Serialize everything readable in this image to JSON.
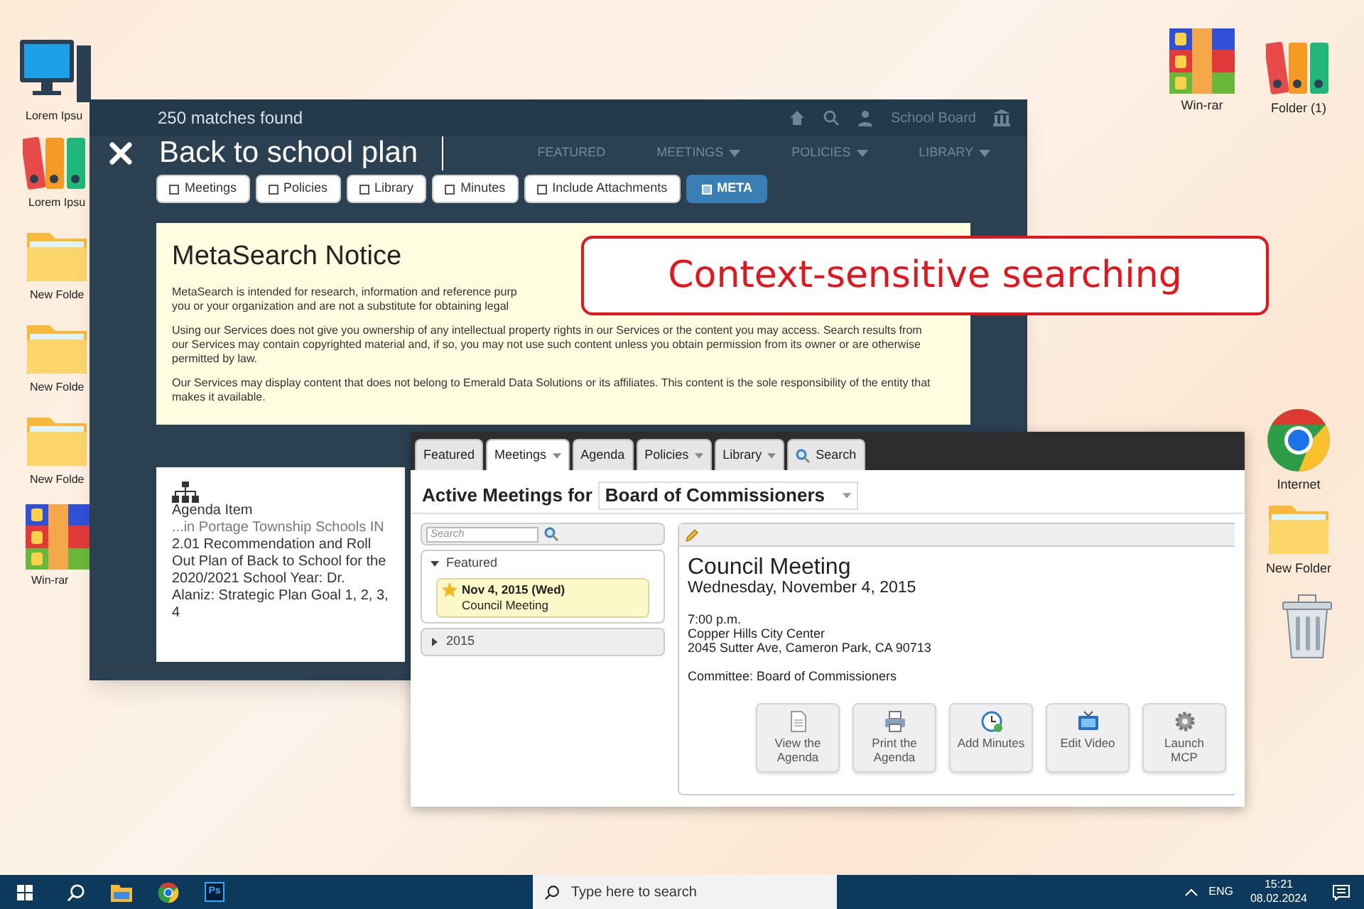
{
  "desktop_icons_left": [
    {
      "kind": "computer",
      "label": "Lorem Ipsu"
    },
    {
      "kind": "binders",
      "label": "Lorem Ipsu"
    },
    {
      "kind": "folder",
      "label": "New Folde"
    },
    {
      "kind": "folder",
      "label": "New Folde"
    },
    {
      "kind": "folder",
      "label": "New Folde"
    },
    {
      "kind": "winrar",
      "label": "Win-rar"
    }
  ],
  "desktop_icons_right": [
    {
      "kind": "winrar",
      "label": "Win-rar"
    },
    {
      "kind": "binders",
      "label": "Folder (1)"
    },
    {
      "kind": "chrome",
      "label": "Internet"
    },
    {
      "kind": "folder",
      "label": "New Folder"
    },
    {
      "kind": "trash"
    }
  ],
  "site_header": {
    "account": "School Board",
    "nav": [
      {
        "label": "FEATURED",
        "dropdown": false
      },
      {
        "label": "MEETINGS",
        "dropdown": true
      },
      {
        "label": "POLICIES",
        "dropdown": true
      },
      {
        "label": "LIBRARY",
        "dropdown": true
      }
    ]
  },
  "metasearch": {
    "match_count": "250 matches found",
    "query": "Back to school plan",
    "filters": [
      {
        "label": "Meetings",
        "checked": false
      },
      {
        "label": "Policies",
        "checked": false
      },
      {
        "label": "Library",
        "checked": false
      },
      {
        "label": "Minutes",
        "checked": false
      },
      {
        "label": "Include Attachments",
        "checked": false
      },
      {
        "label": "META",
        "checked": true
      }
    ],
    "notice": {
      "title": "MetaSearch Notice",
      "cut_lines": [
        "MetaSearch is intended for research, information and reference purp",
        "you or your organization and are not a substitute for obtaining legal"
      ],
      "paragraphs": [
        "Using our Services does not give you ownership of any intellectual property rights in our Services or the content you may access. Search results from our Services may contain copyrighted material and, if so, you may not use such content unless you obtain permission from its owner or are otherwise permitted by law.",
        "Our Services may display content that does not belong to Emerald Data Solutions or its affiliates. This content is the sole responsibility of the entity that makes it available."
      ]
    },
    "results": [
      {
        "type": "Agenda Item",
        "source": "...in Portage Township Schools IN",
        "text": "2.01 Recommendation and Roll Out Plan of Back to School for the 2020/2021 School Year: Dr. Alaniz: Strategic Plan Goal 1, 2, 3, 4"
      }
    ]
  },
  "callout": "Context-sensitive searching",
  "meetings_window": {
    "tabs": [
      {
        "label": "Featured",
        "kind": "plain",
        "selected": false
      },
      {
        "label": "Meetings",
        "kind": "menu",
        "selected": true
      },
      {
        "label": "Agenda",
        "kind": "plain",
        "selected": false
      },
      {
        "label": "Policies",
        "kind": "menu",
        "selected": false
      },
      {
        "label": "Library",
        "kind": "menu",
        "selected": false
      },
      {
        "label": "Search",
        "kind": "search",
        "selected": false
      }
    ],
    "heading": "Active Meetings for",
    "body_select": "Board of Commissioners",
    "search": {
      "placeholder": "Search"
    },
    "tree": [
      {
        "label": "Featured",
        "expanded": true,
        "children": [
          {
            "date": "Nov 4, 2015 (Wed)",
            "title": "Council Meeting",
            "starred": true
          }
        ]
      },
      {
        "label": "2015",
        "expanded": false
      }
    ],
    "detail": {
      "title": "Council Meeting",
      "date": "Wednesday, November 4, 2015",
      "time": "7:00 p.m.",
      "location": [
        "Copper Hills City Center",
        "2045 Sutter Ave, Cameron Park, CA 90713"
      ],
      "committee": "Committee: Board of Commissioners",
      "actions": [
        {
          "kind": "document",
          "label": "View the Agenda"
        },
        {
          "kind": "printer",
          "label": "Print the Agenda"
        },
        {
          "kind": "clock",
          "label": "Add Minutes"
        },
        {
          "kind": "tv",
          "label": "Edit Video"
        },
        {
          "kind": "gear",
          "label": "Launch MCP"
        }
      ]
    }
  },
  "taskbar": {
    "pinned": [
      {
        "kind": "explorer"
      },
      {
        "kind": "chrome"
      },
      {
        "kind": "photoshop",
        "label": "Ps"
      }
    ],
    "search": {
      "placeholder": "Type here to search"
    },
    "language": "ENG",
    "time": "15:21",
    "date": "08.02.2024"
  }
}
